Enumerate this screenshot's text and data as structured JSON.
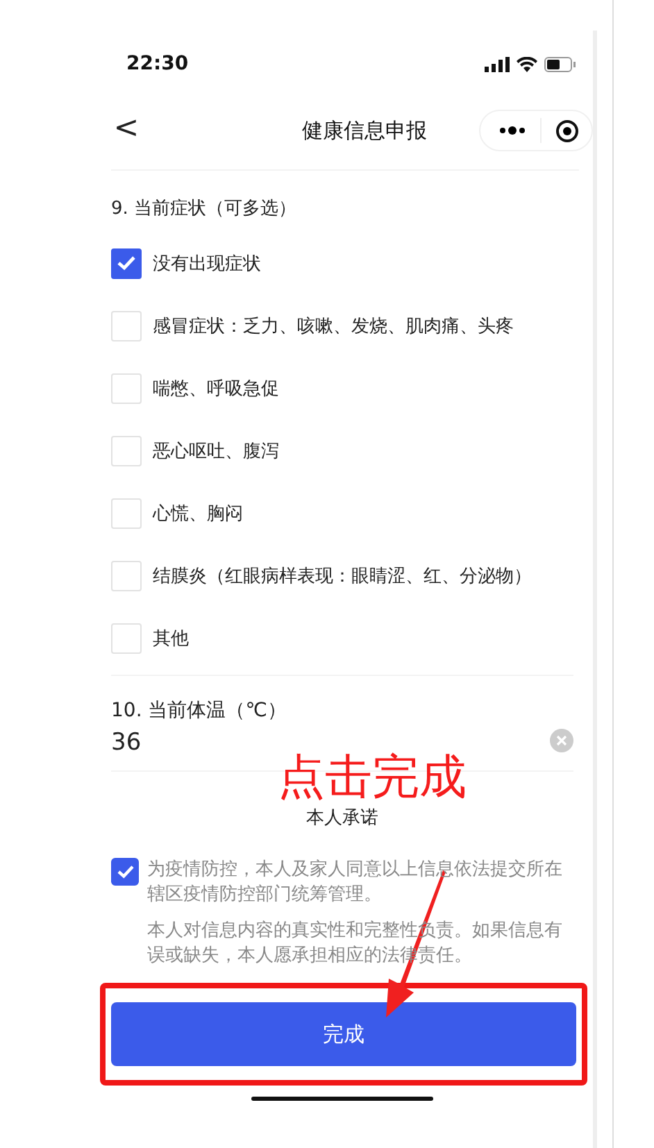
{
  "status_bar": {
    "time": "22:30"
  },
  "nav": {
    "back": "<",
    "title": "健康信息申报"
  },
  "question_9": {
    "label": "9. 当前症状（可多选）",
    "options": [
      {
        "label": "没有出现症状",
        "checked": true
      },
      {
        "label": "感冒症状：乏力、咳嗽、发烧、肌肉痛、头疼",
        "checked": false
      },
      {
        "label": "喘憋、呼吸急促",
        "checked": false
      },
      {
        "label": "恶心呕吐、腹泻",
        "checked": false
      },
      {
        "label": "心慌、胸闷",
        "checked": false
      },
      {
        "label": "结膜炎（红眼病样表现：眼睛涩、红、分泌物）",
        "checked": false
      },
      {
        "label": "其他",
        "checked": false
      }
    ]
  },
  "question_10": {
    "label": "10. 当前体温（℃）",
    "value": "36"
  },
  "pledge": {
    "title": "本人承诺",
    "checked": true,
    "text": "为疫情防控，本人及家人同意以上信息依法提交所在辖区疫情防控部门统筹管理。",
    "note": "本人对信息内容的真实性和完整性负责。如果信息有误或缺失，本人愿承担相应的法律责任。"
  },
  "submit_button": "完成",
  "annotation": {
    "text": "点击完成"
  }
}
